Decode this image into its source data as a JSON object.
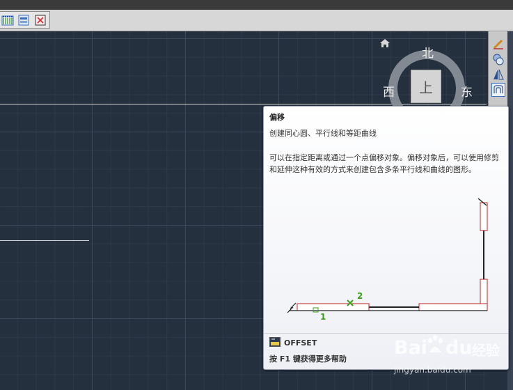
{
  "viewcube": {
    "north": "北",
    "west": "西",
    "east": "东",
    "face": "上"
  },
  "tooltip": {
    "title": "偏移",
    "subtitle": "创建同心圆、平行线和等距曲线",
    "description": "可以在指定距离或通过一个点偏移对象。偏移对象后，可以使用修剪和延伸这种有效的方式来创建包含多条平行线和曲线的图形。",
    "illustration": {
      "label_1": "1",
      "label_2": "2"
    },
    "command_name": "OFFSET",
    "help_text": "按 F1 键获得更多帮助"
  },
  "watermark": {
    "brand": "Bai",
    "brand2": "du",
    "brand_cn": "经验",
    "url": "jingyan.baidu.com"
  },
  "icons": {
    "toolbar": [
      "hatch-icon",
      "gradient-icon",
      "boundary-icon"
    ],
    "panel": [
      "erase-icon",
      "copy-icon",
      "mirror-icon",
      "offset-icon"
    ]
  },
  "colors": {
    "canvas": "#25303f",
    "accent_green": "#3aa01b",
    "illus_red": "#e06060"
  }
}
